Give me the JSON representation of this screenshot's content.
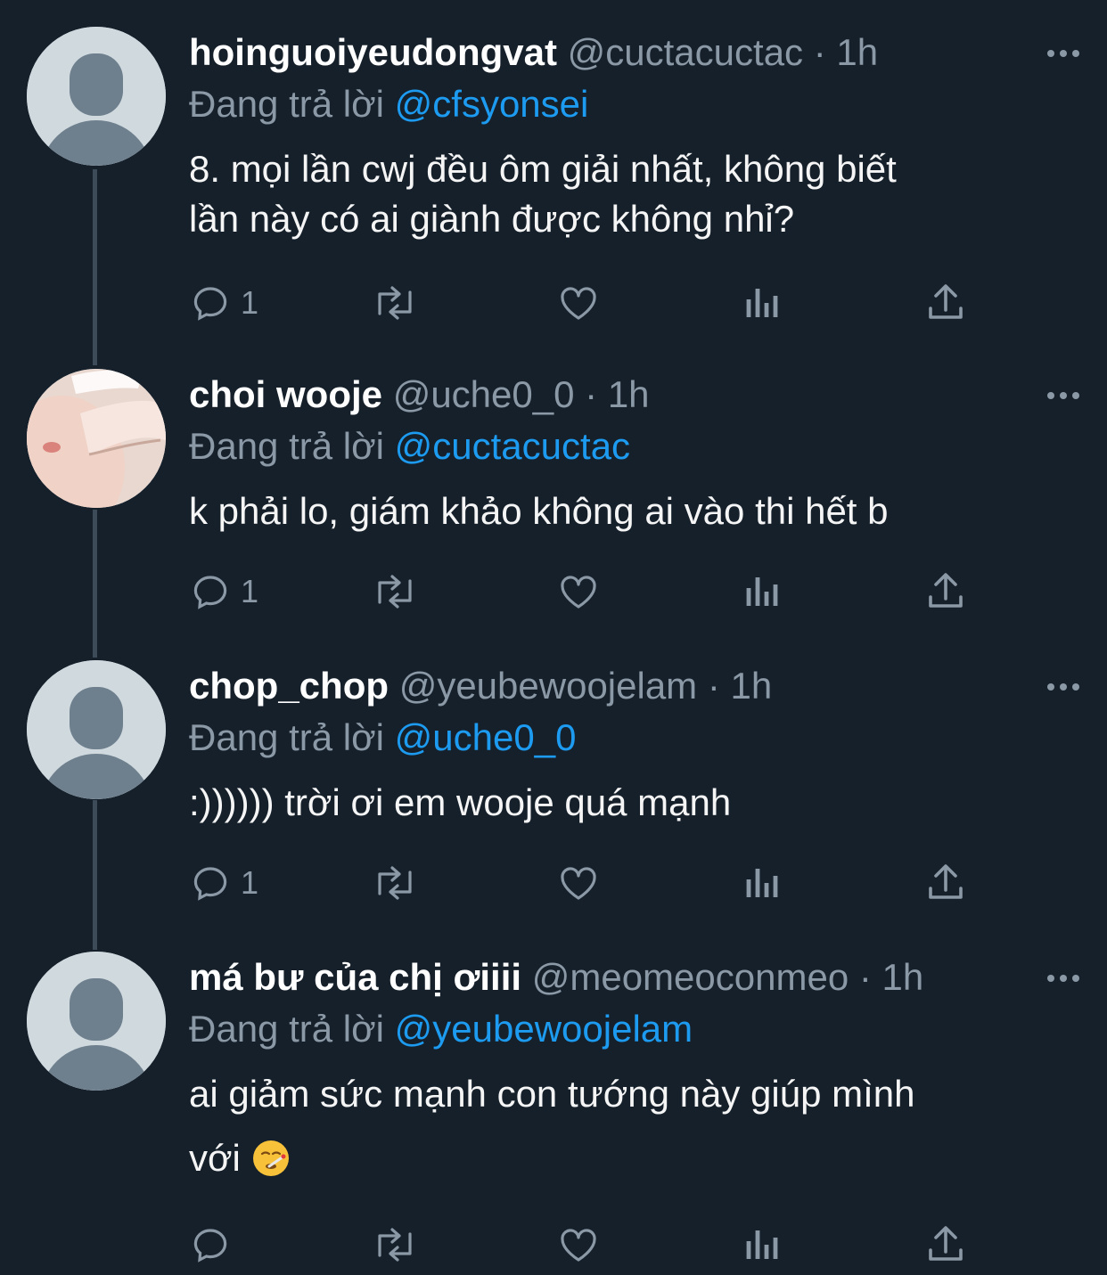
{
  "tweets": [
    {
      "display_name": "hoinguoiyeudongvat",
      "handle": "@cuctacuctac",
      "separator": "·",
      "time": "1h",
      "reply_prefix": "Đang trả lời",
      "reply_to": "@cfsyonsei",
      "text_lines": [
        "8. mọi lần cwj đều ôm giải nhất, không biết",
        "lần này có ai giành được không nhỉ?"
      ],
      "reply_count": "1",
      "avatar": "default-avatar"
    },
    {
      "display_name": "choi wooje",
      "handle": "@uche0_0",
      "separator": "·",
      "time": "1h",
      "reply_prefix": "Đang trả lời",
      "reply_to": "@cuctacuctac",
      "text_lines": [
        "k phải lo, giám khảo không ai vào thi hết b"
      ],
      "reply_count": "1",
      "avatar": "photo-avatar"
    },
    {
      "display_name": "chop_chop",
      "handle": "@yeubewoojelam",
      "separator": "·",
      "time": "1h",
      "reply_prefix": "Đang trả lời",
      "reply_to": "@uche0_0",
      "text_lines": [
        ":)))))) trời ơi em wooje quá mạnh"
      ],
      "reply_count": "1",
      "avatar": "default-avatar"
    },
    {
      "display_name": "má bư của chị ơiiii",
      "handle": "@meomeoconmeo",
      "separator": "·",
      "time": "1h",
      "reply_prefix": "Đang trả lời",
      "reply_to": "@yeubewoojelam",
      "text_lines": [
        "ai giảm sức mạnh con tướng này giúp mình",
        "với"
      ],
      "reply_count": "",
      "emoji": "face-with-thermometer-emoji",
      "avatar": "default-avatar"
    }
  ],
  "colors": {
    "background": "#15202b",
    "mention": "#1d9bf0",
    "muted": "#8b98a5",
    "thread_line": "#3d4a57"
  }
}
